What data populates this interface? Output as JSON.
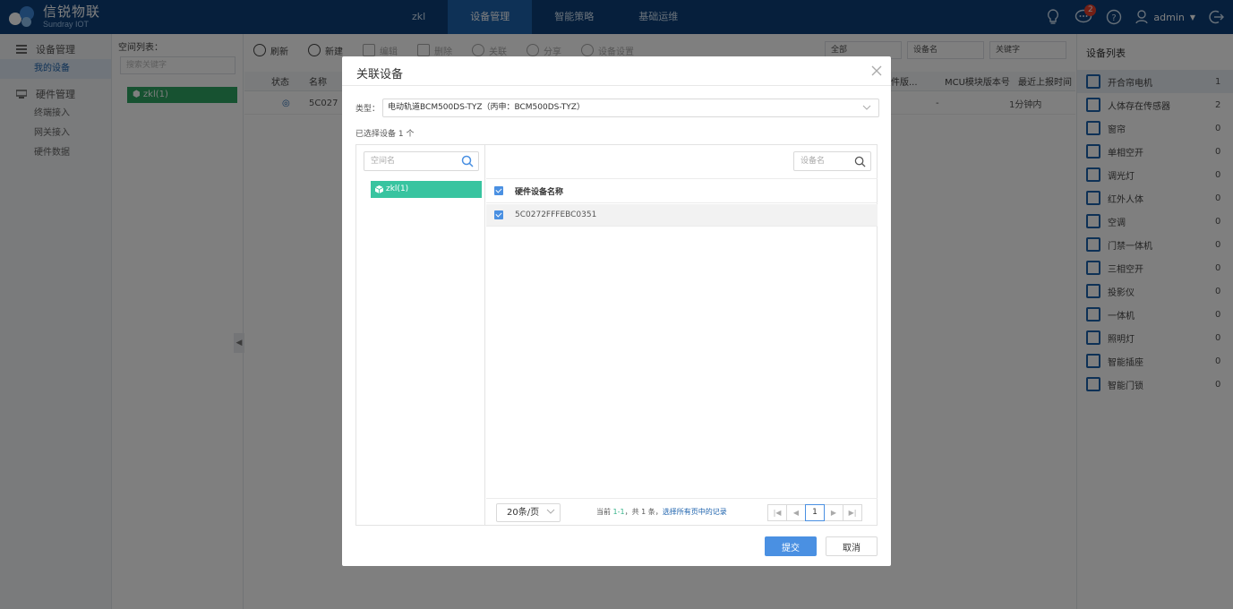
{
  "app": {
    "logo_cn": "信锐物联",
    "logo_en": "Sundray IOT",
    "nav": [
      "zkl",
      "设备管理",
      "智能策略",
      "基础运维"
    ],
    "active_nav": 1,
    "notifications_count": "2",
    "user": "admin",
    "accent_color": "#0c3f78"
  },
  "sidebar": {
    "groups": [
      {
        "label": "设备管理",
        "items": [
          {
            "label": "我的设备",
            "active": true
          }
        ]
      },
      {
        "label": "硬件管理",
        "items": [
          {
            "label": "终端接入"
          },
          {
            "label": "网关接入"
          },
          {
            "label": "硬件数据"
          }
        ]
      }
    ]
  },
  "space_panel": {
    "title": "空间列表：",
    "search_placeholder": "搜索关键字",
    "node": "zkl(1)"
  },
  "toolbar": {
    "refresh": "刷新",
    "add": "新建",
    "edit": "编辑",
    "delete": "删除",
    "associate": "关联",
    "share": "分享",
    "settings": "设备设置",
    "filter_all": "全部",
    "filter_field": "设备名",
    "keyword_placeholder": "关键字"
  },
  "table": {
    "headers": [
      "状态",
      "名称",
      "固件版...",
      "MCU模块版本号",
      "最近上报时间"
    ],
    "row": {
      "name": "5C027",
      "mcu": "-",
      "last_report": "1分钟内"
    }
  },
  "device_list": {
    "title": "设备列表",
    "items": [
      {
        "name": "开合帘电机",
        "count": "1"
      },
      {
        "name": "人体存在传感器",
        "count": "2"
      },
      {
        "name": "窗帘",
        "count": "0"
      },
      {
        "name": "单相空开",
        "count": "0"
      },
      {
        "name": "调光灯",
        "count": "0"
      },
      {
        "name": "红外人体",
        "count": "0"
      },
      {
        "name": "空调",
        "count": "0"
      },
      {
        "name": "门禁一体机",
        "count": "0"
      },
      {
        "name": "三相空开",
        "count": "0"
      },
      {
        "name": "投影仪",
        "count": "0"
      },
      {
        "name": "一体机",
        "count": "0"
      },
      {
        "name": "照明灯",
        "count": "0"
      },
      {
        "name": "智能插座",
        "count": "0"
      },
      {
        "name": "智能门锁",
        "count": "0"
      }
    ]
  },
  "dialog": {
    "title": "关联设备",
    "type_label": "类型：",
    "type_value": "电动轨道BCM500DS-TYZ（丙申：BCM500DS-TYZ）",
    "selected_text": "已选择设备 1 个",
    "tree_search_placeholder": "空间名",
    "tree_node": "zkl(1)",
    "device_search_placeholder": "设备名",
    "column_header": "硬件设备名称",
    "rows": [
      "5C0272FFFEBC0351"
    ],
    "page_size": "20条/页",
    "page_info_prefix": "当前",
    "page_info_range": "1-1",
    "page_info_total": "，共 1 条，",
    "page_info_link": "选择所有页中的记录",
    "current_page": "1",
    "submit": "提交",
    "cancel": "取消",
    "primary_color": "#4a90e2",
    "tree_node_color": "#38c4a0"
  }
}
